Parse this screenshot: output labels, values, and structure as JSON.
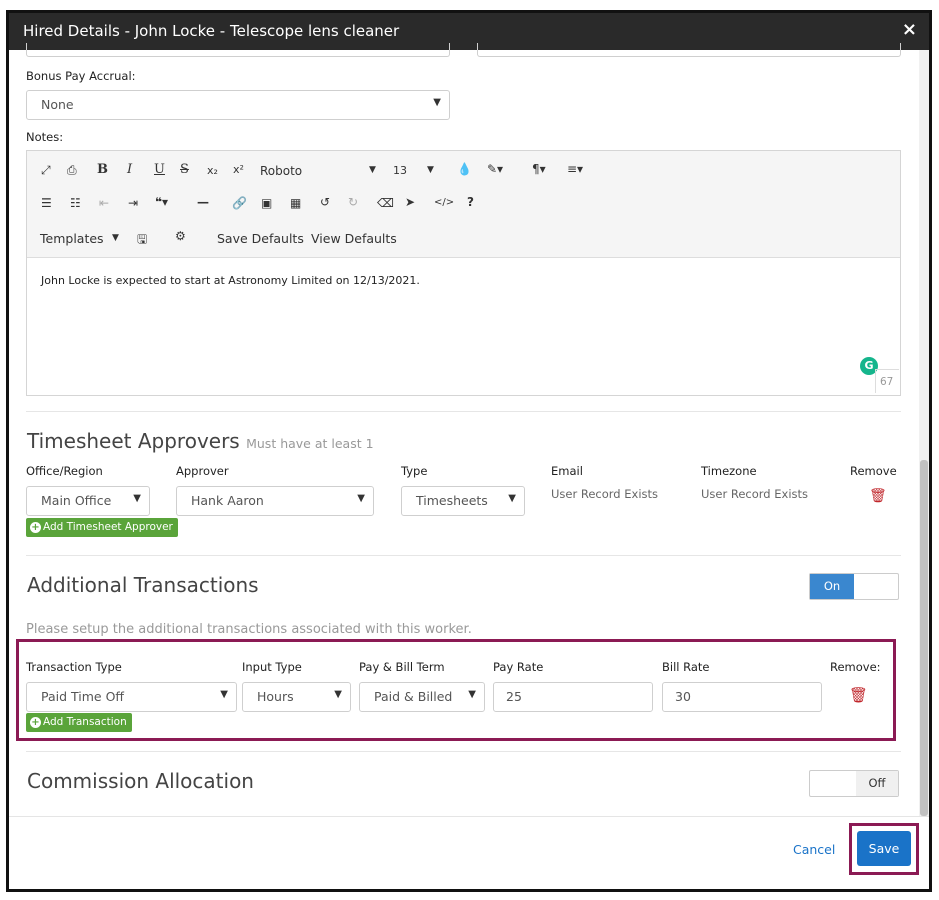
{
  "modal": {
    "title": "Hired Details - John Locke - Telescope lens cleaner",
    "close_glyph": "×"
  },
  "bonus": {
    "label": "Bonus Pay Accrual:",
    "value": "None"
  },
  "notes": {
    "label": "Notes:",
    "content": "John Locke is expected to start at Astronomy Limited on 12/13/2021.",
    "char_count": "67"
  },
  "toolbar": {
    "row1": {
      "font_family": "Roboto",
      "font_size": "13"
    },
    "row3": {
      "templates": "Templates",
      "save_defaults": "Save Defaults",
      "view_defaults": "View Defaults"
    }
  },
  "timesheet": {
    "title": "Timesheet Approvers",
    "subtitle": "Must have at least 1",
    "headers": {
      "office": "Office/Region",
      "approver": "Approver",
      "type": "Type",
      "email": "Email",
      "timezone": "Timezone",
      "remove": "Remove"
    },
    "row": {
      "office": "Main Office",
      "approver": "Hank Aaron",
      "type": "Timesheets",
      "email": "User Record Exists",
      "timezone": "User Record Exists"
    },
    "add_button": "Add Timesheet Approver"
  },
  "additional": {
    "title": "Additional Transactions",
    "toggle_label": "On",
    "description": "Please setup the additional transactions associated with this worker.",
    "headers": {
      "transaction_type": "Transaction Type",
      "input_type": "Input Type",
      "pay_bill_term": "Pay & Bill Term",
      "pay_rate": "Pay Rate",
      "bill_rate": "Bill Rate",
      "remove": "Remove:"
    },
    "row": {
      "transaction_type": "Paid Time Off",
      "input_type": "Hours",
      "pay_bill_term": "Paid & Billed",
      "pay_rate": "25",
      "bill_rate": "30"
    },
    "add_button": "Add Transaction"
  },
  "commission": {
    "title": "Commission Allocation",
    "toggle_label": "Off"
  },
  "footer": {
    "cancel": "Cancel",
    "save": "Save"
  },
  "colors": {
    "title_bar": "#2a2a2a",
    "primary_blue": "#1a73c8",
    "green": "#5aa43a",
    "highlight": "#8b1a54",
    "remove_red": "#c0262b"
  }
}
